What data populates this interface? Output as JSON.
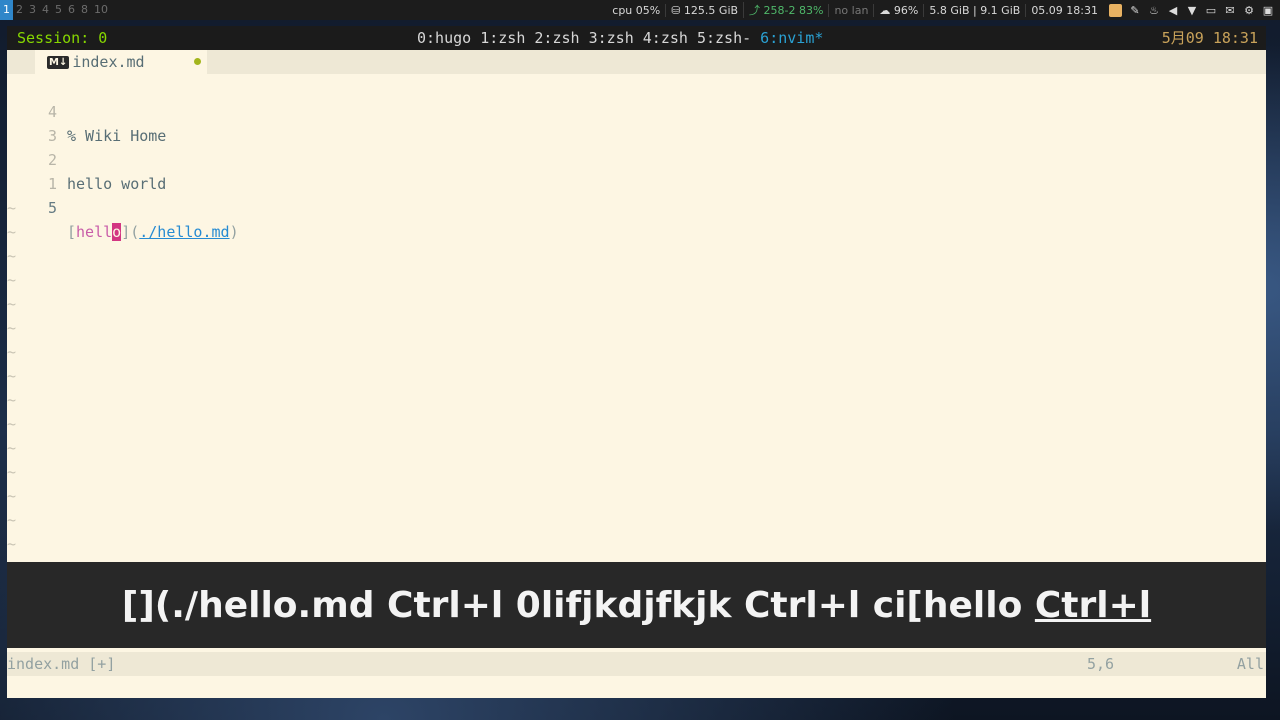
{
  "topbar": {
    "workspaces": [
      "1",
      "2",
      "3",
      "4",
      "5",
      "6",
      "8",
      "10"
    ],
    "active_workspace": "1",
    "cpu": "cpu  05%",
    "disk": "⛁ 125.5 GiB",
    "updates": "⤴ 258-2  83%",
    "lan": "no lan",
    "wifi": "☁ 96%",
    "mem": "5.8 GiB | 9.1 GiB",
    "datetime": "05.09 18:31"
  },
  "tmux": {
    "session": "Session: 0",
    "windows_prefix": "0:hugo 1:zsh 2:zsh 3:zsh 4:zsh 5:zsh- ",
    "current_window": "6:nvim*",
    "clock": "5月09 18:31"
  },
  "tabline": {
    "icon": "M↓",
    "filename": "index.md"
  },
  "buffer": {
    "lines": [
      {
        "num": "4",
        "text": "% Wiki Home"
      },
      {
        "num": "3",
        "text": ""
      },
      {
        "num": "2",
        "text": "hello world"
      },
      {
        "num": "1",
        "text": ""
      }
    ],
    "current_line": {
      "num": "5",
      "open_bracket": "[",
      "link_before_cursor": "hell",
      "cursor_char": "o",
      "close_paren_open": "](",
      "url": "./hello.md",
      "close_paren": ")"
    },
    "tilde": "~"
  },
  "keycast": {
    "text": "[](./hello.md Ctrl+l 0lifjkdjfkjk Ctrl+l ci[hello ",
    "last_key": "Ctrl+l"
  },
  "statusline": {
    "filename": "index.md [+]",
    "position": "5,6",
    "scroll": "All"
  }
}
